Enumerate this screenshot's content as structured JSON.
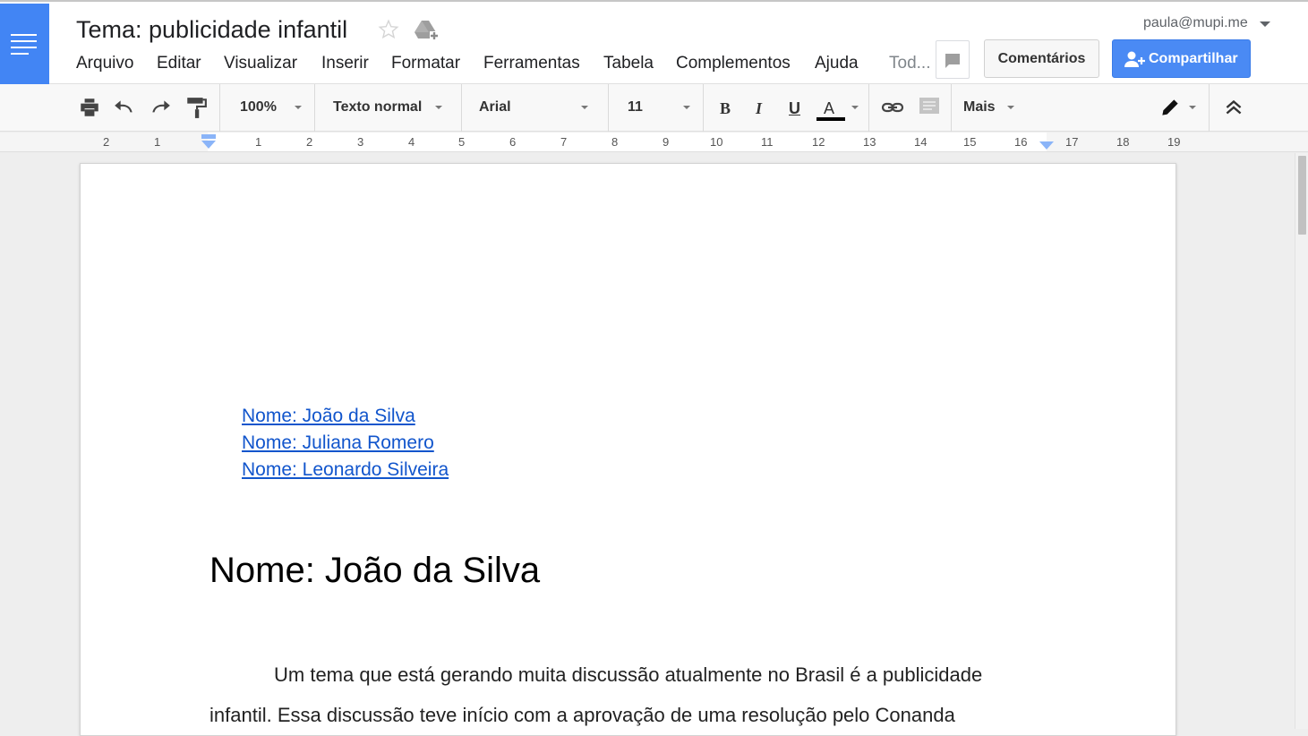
{
  "header": {
    "title": "Tema: publicidade infantil",
    "user_email": "paula@mupi.me",
    "comments_label": "Comentários",
    "share_label": "Compartilhar"
  },
  "menu": [
    "Arquivo",
    "Editar",
    "Visualizar",
    "Inserir",
    "Formatar",
    "Ferramentas",
    "Tabela",
    "Complementos",
    "Ajuda",
    "Tod..."
  ],
  "toolbar": {
    "zoom": "100%",
    "style": "Texto normal",
    "font": "Arial",
    "font_size": "11",
    "bold_glyph": "B",
    "italic_glyph": "I",
    "underline_glyph": "U",
    "text_color_glyph": "A",
    "more_label": "Mais",
    "text_color": "#000000"
  },
  "ruler": {
    "left_labels": [
      "2",
      "1"
    ],
    "labels": [
      "1",
      "2",
      "3",
      "4",
      "5",
      "6",
      "7",
      "8",
      "9",
      "10",
      "11",
      "12",
      "13",
      "14",
      "15",
      "16",
      "17",
      "18",
      "19"
    ]
  },
  "document": {
    "toc": [
      "Nome: João da Silva",
      "Nome: Juliana Romero",
      "Nome: Leonardo Silveira"
    ],
    "heading": "Nome: João da Silva",
    "paragraph_lines": [
      "Um tema que está gerando muita discussão atualmente no Brasil é a publicidade",
      "infantil. Essa discussão teve início com a aprovação de uma resolução pelo Conanda"
    ]
  },
  "colors": {
    "brand_blue": "#4285f4",
    "share_blue": "#4a8af4",
    "link_blue": "#1155cc"
  }
}
